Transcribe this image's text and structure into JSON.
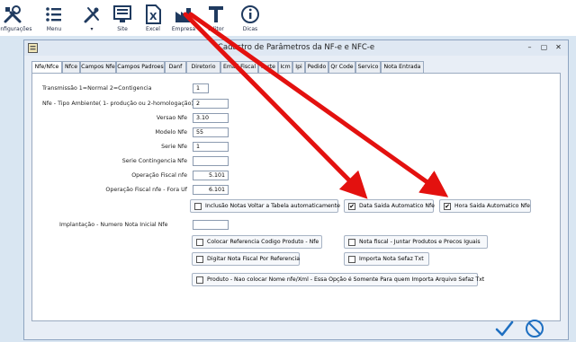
{
  "toolbar": {
    "items": [
      {
        "label": "Configurações",
        "icon": "tools-icon"
      },
      {
        "label": "Menu",
        "icon": "list-menu-icon"
      },
      {
        "label": "",
        "icon": "wand-dropdown-icon"
      },
      {
        "label": "Site",
        "icon": "site-monitor-icon"
      },
      {
        "label": "Excel",
        "icon": "excel-icon"
      },
      {
        "label": "Empresa",
        "icon": "factory-icon"
      },
      {
        "label": "Editor",
        "icon": "text-editor-icon"
      },
      {
        "label": "Dicas",
        "icon": "info-icon"
      }
    ],
    "dropdown_glyph": "▾"
  },
  "window": {
    "title": "Cadastro de Parâmetros da NF-e e NFC-e",
    "controls": {
      "minimize": "–",
      "maximize": "▢",
      "close": "✕"
    }
  },
  "tabs": [
    "Nfe/Nfce",
    "Nfce",
    "Campos Nfe",
    "Campos Padroes",
    "Danf",
    "Diretorio",
    "Email Fiscal",
    "Forte",
    "Icm",
    "Ipi",
    "Pedido",
    "Qr Code",
    "Servico",
    "Nota Entrada"
  ],
  "active_tab": "Nfe/Nfce",
  "fields": {
    "transmissao": {
      "label": "Transmissão 1=Normal 2=Contigencia",
      "value": "1"
    },
    "ambiente": {
      "label": "Nfe - Tipo Ambiente( 1- produção ou 2-homologação)",
      "value": "2"
    },
    "versao": {
      "label": "Versao Nfe",
      "value": "3.10"
    },
    "modelo": {
      "label": "Modelo Nfe",
      "value": "55"
    },
    "serie": {
      "label": "Serie Nfe",
      "value": "1"
    },
    "serie_contingencia": {
      "label": "Serie Contingencia Nfe",
      "value": ""
    },
    "operacao_fiscal": {
      "label": "Operação Fiscal nfe",
      "value": "5.101"
    },
    "operacao_fiscal_fora": {
      "label": "Operação Fiscal nfe - Fora Uf",
      "value": "6.101"
    },
    "implantacao": {
      "label": "Implantação - Numero Nota Inicial Nfe",
      "value": ""
    }
  },
  "checkboxes": {
    "inclusao_notas": {
      "label": "Inclusão Notas Voltar a Tabela automaticamente",
      "checked": false
    },
    "data_saida": {
      "label": "Data Saida Automatico Nfe",
      "checked": true
    },
    "hora_saida": {
      "label": "Hora Saida Automatico Nfe",
      "checked": true
    },
    "colocar_referencia": {
      "label": "Colocar Referencia Codigo Produto - Nfe",
      "checked": false
    },
    "nota_fiscal_juntar": {
      "label": "Nota fiscal - Juntar Produtos e Precos Iguais",
      "checked": false
    },
    "digitar_nota": {
      "label": "Digitar Nota Fiscal Por Referencia",
      "checked": false
    },
    "importa_nota": {
      "label": "Importa Nota Sefaz Txt",
      "checked": false
    },
    "produto_nao_colocar": {
      "label": "Produto - Nao colocar Nome nfe/Xml - Essa Opção é Somente Para quem Importa Arquivo Sefaz Txt",
      "checked": false
    }
  },
  "check_glyph": "✔",
  "colors": {
    "arrow": "#e3110f",
    "accent": "#1e6fc1",
    "cancel": "#1e6fc1"
  }
}
